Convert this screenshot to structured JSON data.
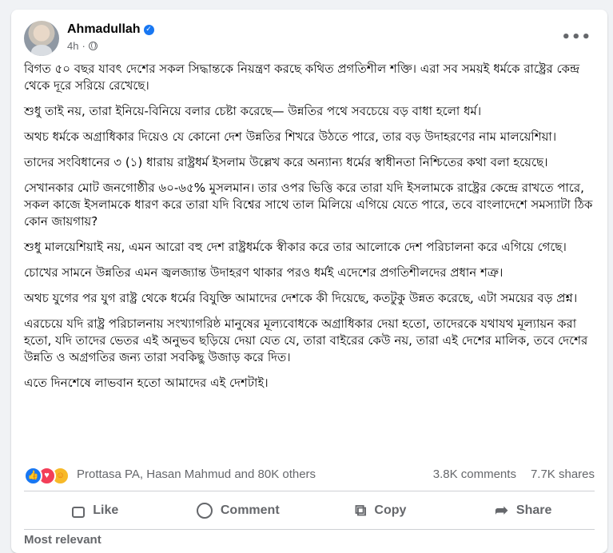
{
  "post": {
    "author": "Ahmadullah",
    "time": "4h",
    "paragraphs": [
      "বিগত ৫০ বছর যাবৎ দেশের সকল সিদ্ধান্তকে নিয়ন্ত্রণ করছে কথিত প্রগতিশীল শক্তি। এরা সব সময়ই ধর্মকে রাষ্ট্রের কেন্দ্র থেকে দূরে সরিয়ে রেখেছে।",
      "শুধু তাই নয়, তারা ইনিয়ে-বিনিয়ে বলার চেষ্টা করেছে— উন্নতির পথে সবচেয়ে বড় বাধা হলো ধর্ম।",
      "অথচ ধর্মকে অগ্রাধিকার দিয়েও যে কোনো দেশ উন্নতির শিখরে উঠতে পারে, তার বড় উদাহরণের নাম মালয়েশিয়া।",
      "তাদের সংবিধানের ৩ (১) ধারায় রাষ্ট্রধর্ম ইসলাম উল্লেখ করে অন্যান্য ধর্মের স্বাধীনতা নিশ্চিতের কথা বলা হয়েছে।",
      "সেখানকার মোট জনগোষ্ঠীর ৬০-৬৫% মুসলমান। তার ওপর ভিত্তি করে তারা যদি ইসলামকে রাষ্ট্রের কেন্দ্রে রাখতে পারে, সকল কাজে ইসলামকে ধারণ করে তারা যদি বিশ্বের সাথে তাল মিলিয়ে এগিয়ে যেতে পারে, তবে বাংলাদেশে সমস্যাটা ঠিক কোন জায়গায়?",
      "শুধু মালয়েশিয়াই নয়, এমন আরো বহু দেশ রাষ্ট্রধর্মকে স্বীকার করে তার আলোকে দেশ পরিচালনা করে এগিয়ে গেছে।",
      "চোখের সামনে উন্নতির এমন জ্বলজ্যান্ত উদাহরণ থাকার পরও ধর্মই এদেশের প্রগতিশীলদের প্রধান শত্রু।",
      "অথচ যুগের পর যুগ রাষ্ট্র থেকে ধর্মের বিযুক্তি আমাদের দেশকে কী দিয়েছে, কতটুকু উন্নত করেছে, এটা সময়ের বড় প্রশ্ন।",
      "এরচেয়ে যদি রাষ্ট্র পরিচালনায় সংখ্যাগরিষ্ঠ মানুষের মূল্যবোধকে অগ্রাধিকার দেয়া হতো, তাদেরকে যথাযথ মূল্যায়ন করা হতো, যদি তাদের ভেতর এই অনুভব ছড়িয়ে দেয়া যেত যে, তারা বাইরের কেউ নয়, তারা এই দেশের মালিক, তবে দেশের উন্নতি ও অগ্রগতির জন্য তারা সবকিছু উজাড় করে দিত।",
      "এতে দিনশেষে লাভবান হতো আমাদের এই দেশটাই।"
    ]
  },
  "reactions": {
    "names": "Prottasa PA, Hasan Mahmud and 80K others",
    "comments": "3.8K comments",
    "shares": "7.7K shares"
  },
  "actions": {
    "like": "Like",
    "comment": "Comment",
    "copy": "Copy",
    "share": "Share"
  },
  "sort_label": "Most relevant",
  "icons": [
    "more-options-icon",
    "verified-icon",
    "globe-icon",
    "like-reaction-icon",
    "love-reaction-icon",
    "care-reaction-icon",
    "like-icon",
    "comment-icon",
    "copy-icon",
    "share-icon"
  ],
  "colors": {
    "accent": "#1877f2",
    "love": "#f33e58",
    "care": "#f7b928",
    "muted": "#65676b"
  }
}
